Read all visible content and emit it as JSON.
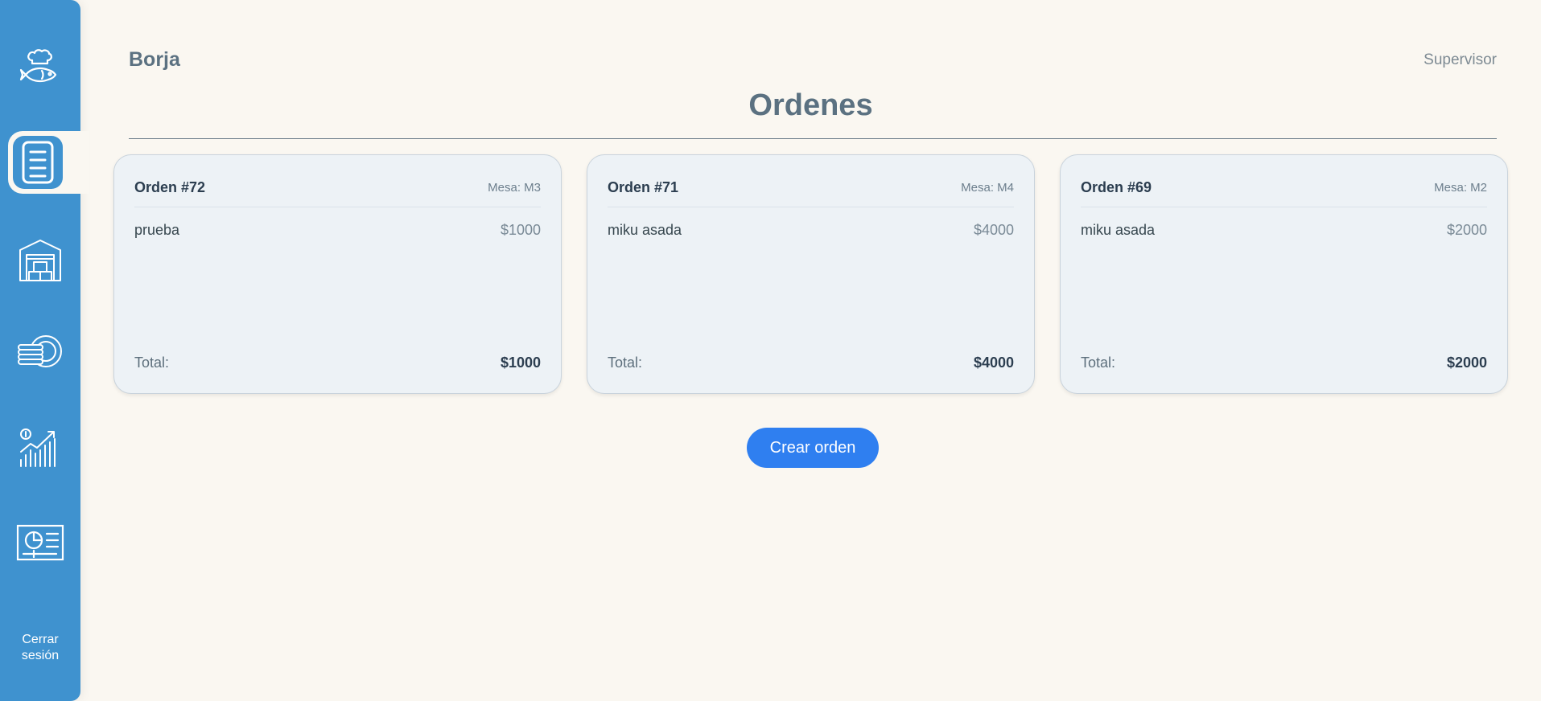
{
  "user": {
    "name": "Borja",
    "role": "Supervisor"
  },
  "page": {
    "title": "Ordenes"
  },
  "sidebar": {
    "items": [
      {
        "icon": "chef-fish-logo-icon",
        "active": false
      },
      {
        "icon": "orders-list-icon",
        "active": true
      },
      {
        "icon": "warehouse-icon",
        "active": false
      },
      {
        "icon": "dishes-icon",
        "active": false
      },
      {
        "icon": "sales-chart-icon",
        "active": false
      },
      {
        "icon": "report-dashboard-icon",
        "active": false
      }
    ],
    "logout_label_line1": "Cerrar",
    "logout_label_line2": "sesión"
  },
  "orders": [
    {
      "id_label": "Orden #72",
      "table_label": "Mesa: M3",
      "items": [
        {
          "name": "prueba",
          "price": "$1000"
        }
      ],
      "total_label": "Total:",
      "total_value": "$1000"
    },
    {
      "id_label": "Orden #71",
      "table_label": "Mesa: M4",
      "items": [
        {
          "name": "miku asada",
          "price": "$4000"
        }
      ],
      "total_label": "Total:",
      "total_value": "$4000"
    },
    {
      "id_label": "Orden #69",
      "table_label": "Mesa: M2",
      "items": [
        {
          "name": "miku asada",
          "price": "$2000"
        }
      ],
      "total_label": "Total:",
      "total_value": "$2000"
    }
  ],
  "actions": {
    "create_order_label": "Crear orden"
  },
  "colors": {
    "sidebar": "#3f92cf",
    "background": "#faf7f1",
    "card": "#edf2f6",
    "primary_button": "#2f7ff0"
  }
}
